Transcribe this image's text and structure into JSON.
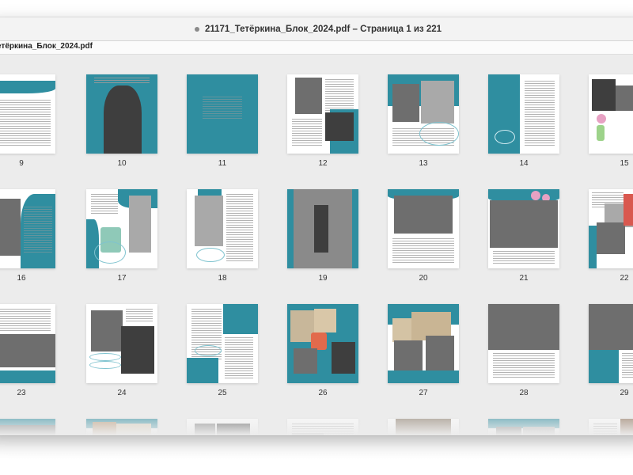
{
  "window": {
    "title": "21171_Тетёркина_Блок_2024.pdf – Страница 1 из 221",
    "tab_label": "етёркина_Блок_2024.pdf"
  },
  "pages": [
    "9",
    "10",
    "11",
    "12",
    "13",
    "14",
    "15",
    "16",
    "17",
    "18",
    "19",
    "20",
    "21",
    "22",
    "23",
    "24",
    "25",
    "26",
    "27",
    "28",
    "29",
    "",
    "",
    "",
    "",
    "",
    "",
    ""
  ],
  "colors": {
    "accent": "#2f8ea0",
    "background": "#ececec"
  }
}
